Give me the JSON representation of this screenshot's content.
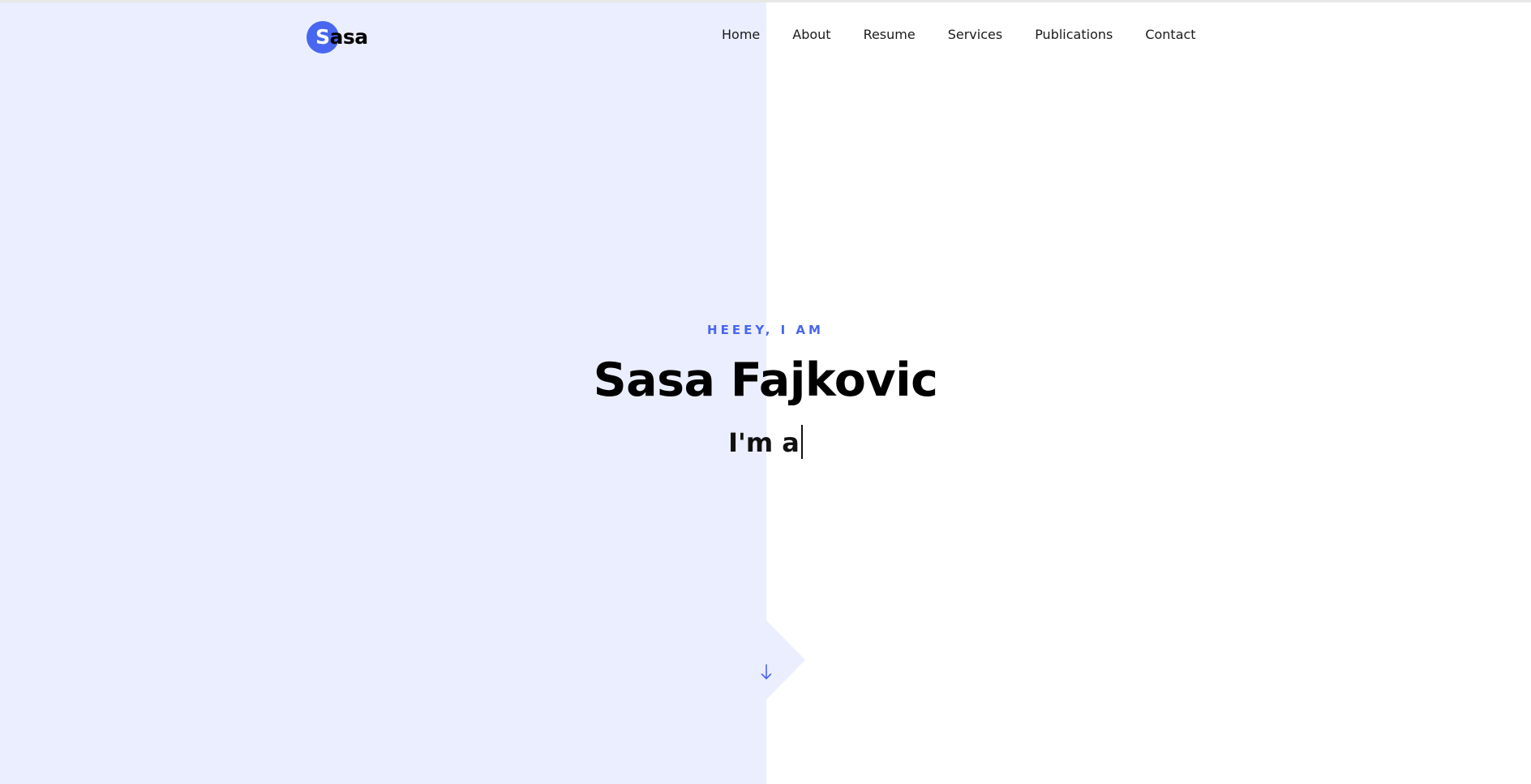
{
  "brand": {
    "logo_initial": "S",
    "logo_rest": "asa",
    "accent_color": "#4866f0",
    "panel_color": "#ebeefe"
  },
  "nav": {
    "items": [
      {
        "label": "Home"
      },
      {
        "label": "About"
      },
      {
        "label": "Resume"
      },
      {
        "label": "Services"
      },
      {
        "label": "Publications"
      },
      {
        "label": "Contact"
      }
    ]
  },
  "hero": {
    "greeting": "HEEEY, I AM",
    "name": "Sasa Fajkovic",
    "typed_prefix": "I'm a"
  },
  "scroll": {
    "icon": "arrow-down-icon"
  }
}
